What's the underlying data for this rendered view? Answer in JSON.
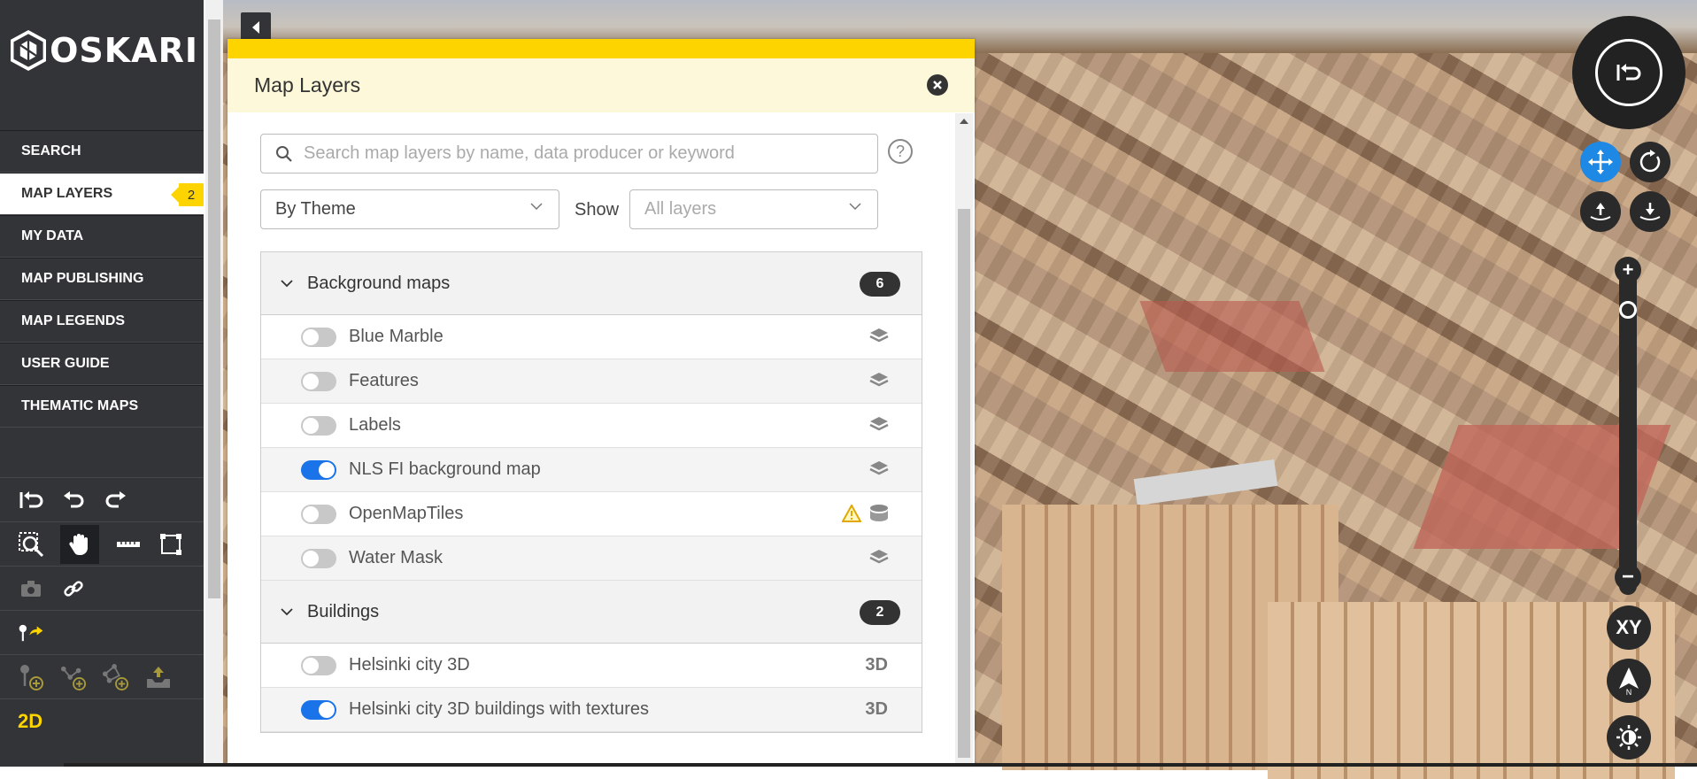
{
  "app": {
    "logo_text": "OSKARI"
  },
  "sidebar": {
    "menu": [
      {
        "label": "SEARCH"
      },
      {
        "label": "MAP LAYERS",
        "badge": "2",
        "active": true
      },
      {
        "label": "MY DATA"
      },
      {
        "label": "MAP PUBLISHING"
      },
      {
        "label": "MAP LEGENDS"
      },
      {
        "label": "USER GUIDE"
      },
      {
        "label": "THEMATIC MAPS"
      }
    ],
    "mode_label": "2D"
  },
  "flyout": {
    "title": "Map Layers",
    "search_placeholder": "Search map layers by name, data producer or keyword",
    "group_by_value": "By Theme",
    "show_label": "Show",
    "show_placeholder": "All layers"
  },
  "layer_groups": [
    {
      "name": "Background maps",
      "count": "6",
      "layers": [
        {
          "name": "Blue Marble",
          "enabled": false,
          "type_icon": "layers-icon"
        },
        {
          "name": "Features",
          "enabled": false,
          "type_icon": "layers-icon"
        },
        {
          "name": "Labels",
          "enabled": false,
          "type_icon": "layers-icon"
        },
        {
          "name": "NLS FI background map",
          "enabled": true,
          "type_icon": "layers-icon"
        },
        {
          "name": "OpenMapTiles",
          "enabled": false,
          "type_icon": "database-icon",
          "warning": true
        },
        {
          "name": "Water Mask",
          "enabled": false,
          "type_icon": "layers-icon"
        }
      ]
    },
    {
      "name": "Buildings",
      "count": "2",
      "layers": [
        {
          "name": "Helsinki city 3D",
          "enabled": false,
          "type_label": "3D"
        },
        {
          "name": "Helsinki city 3D buildings with textures",
          "enabled": true,
          "type_label": "3D"
        }
      ]
    }
  ],
  "map_controls": {
    "xy_label": "XY",
    "north_label": "N"
  },
  "colors": {
    "accent_yellow": "#fdd400",
    "toggle_on": "#1a73e8",
    "sidebar_bg": "#333438"
  }
}
